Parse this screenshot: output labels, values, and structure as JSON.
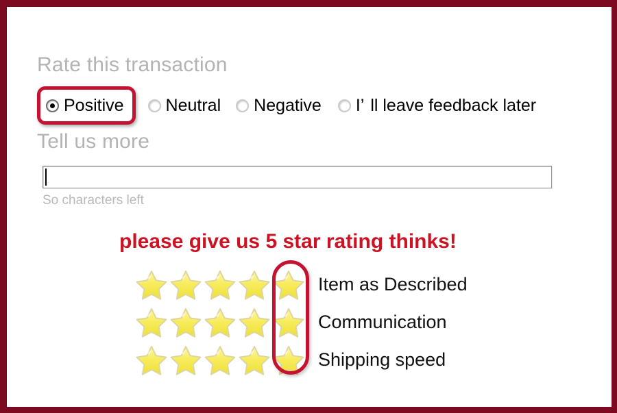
{
  "theme": {
    "frame_color": "#7c0a21",
    "heading_gray": "#b3b3b3",
    "promo_red": "#cc1324",
    "highlight_red": "#c41230",
    "star_yellow": "#f7e952"
  },
  "rate_section": {
    "heading": "Rate this transaction",
    "options": [
      {
        "label": "Positive",
        "selected": true,
        "highlighted": true,
        "icon": "radio-selected-icon"
      },
      {
        "label": "Neutral",
        "selected": false,
        "highlighted": false,
        "icon": "radio-unselected-icon"
      },
      {
        "label": "Negative",
        "selected": false,
        "highlighted": false,
        "icon": "radio-unselected-icon"
      },
      {
        "label_part1": "I’",
        "label_part2": "ll leave feedback later",
        "selected": false,
        "highlighted": false,
        "icon": "radio-unselected-icon"
      }
    ]
  },
  "tell_section": {
    "heading": "Tell us more",
    "input_value": "",
    "input_placeholder": "",
    "characters_left": "So characters left"
  },
  "promo": {
    "text": "please give us 5 star rating thinks!"
  },
  "ratings": {
    "star_count": 5,
    "highlighted_column": 5,
    "rows": [
      {
        "label": "Item as Described",
        "stars": 5
      },
      {
        "label": "Communication",
        "stars": 5
      },
      {
        "label": "Shipping speed",
        "stars": 5
      }
    ]
  }
}
